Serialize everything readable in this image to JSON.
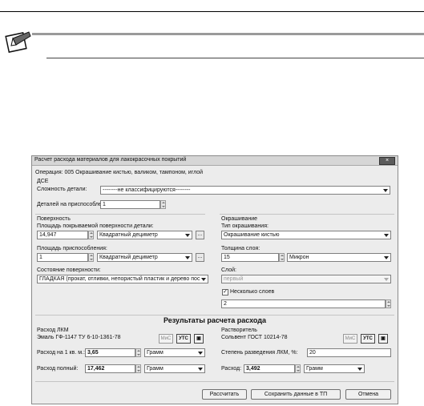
{
  "dialog": {
    "title": "Расчет расхода материалов для лакокрасочных покрытий",
    "close": "×",
    "operation": "Операция: 005 Окрашивание кистью, валиком, тампоном, иглой",
    "dse": {
      "section": "ДСЕ",
      "complexity_label": "Сложность детали:",
      "complexity_value": "--------не классифицируются--------",
      "parts_label": "Деталей на приспособлении:",
      "parts_value": "1"
    },
    "surface": {
      "section": "Поверхность",
      "area_label": "Площадь покрываемой поверхности детали:",
      "area_value": "14,947",
      "area_unit": "Квадратный дециметр",
      "fixture_label": "Площадь приспособления:",
      "fixture_value": "1",
      "fixture_unit": "Квадратный дециметр",
      "state_label": "Состояние поверхности:",
      "state_value": "ГЛАДКАЯ (прокат, отливки, непористый пластик и дерево пос"
    },
    "painting": {
      "section": "Окрашивание",
      "type_label": "Тип окрашивания:",
      "type_value": "Окрашивание кистью",
      "thickness_label": "Толщина слоя:",
      "thickness_value": "15",
      "thickness_unit": "Микрон",
      "layer_label": "Слой:",
      "layer_value": "первый",
      "multi_label": "Несколько слоев",
      "multi_checked": "✓",
      "layers_count": "2"
    },
    "results": {
      "title": "Результаты расчета расхода",
      "lkm": {
        "section": "Расход ЛКМ",
        "material": "Эмаль ГФ-1147 ТУ 6-10-1361-78",
        "btn_mis": "МиС",
        "btn_utc": "УТС",
        "per_m2_label": "Расход на 1 кв. м.:",
        "per_m2_value": "3,65",
        "per_m2_unit": "Грамм",
        "total_label": "Расход полный:",
        "total_value": "17,462",
        "total_unit": "Грамм"
      },
      "solvent": {
        "section": "Растворитель",
        "material": "Сольвент ГОСТ 10214-78",
        "btn_mis": "МиС",
        "btn_utc": "УТС",
        "dilution_label": "Степень разведения ЛКМ, %:",
        "dilution_value": "20",
        "consumption_label": "Расход:",
        "consumption_value": "3,492",
        "consumption_unit": "Грамм"
      }
    },
    "buttons": {
      "calculate": "Рассчитать",
      "save": "Сохранить данные в ТП",
      "cancel": "Отмена"
    }
  }
}
